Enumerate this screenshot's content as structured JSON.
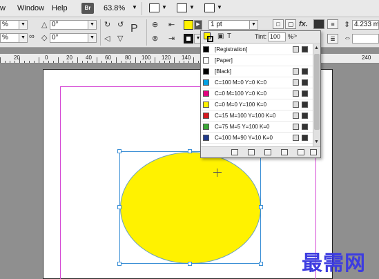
{
  "menubar": {
    "items": [
      "w",
      "Window",
      "Help"
    ],
    "bridge_label": "Br",
    "zoom": "63.8%"
  },
  "control": {
    "stroke_weight": "1 pt",
    "size_field": "4.233 m",
    "angle_1": "0°",
    "angle_2": "0°",
    "left_pct_1": "%",
    "left_pct_2": "%",
    "fx_label": "fx."
  },
  "ruler": {
    "labels": [
      "20",
      "0",
      "20",
      "40",
      "60",
      "80",
      "100",
      "120",
      "140"
    ],
    "right_labels": [
      "240"
    ]
  },
  "swatches_panel": {
    "tint_label": "Tint:",
    "tint_value": "100",
    "tint_unit": "%",
    "swatches": [
      {
        "name": "[Registration]",
        "color": "#000000"
      },
      {
        "name": "[Paper]",
        "color": "#ffffff"
      },
      {
        "name": "[Black]",
        "color": "#000000"
      },
      {
        "name": "C=100 M=0 Y=0 K=0",
        "color": "#00a0e3"
      },
      {
        "name": "C=0 M=100 Y=0 K=0",
        "color": "#e4007f"
      },
      {
        "name": "C=0 M=0 Y=100 K=0",
        "color": "#fff100"
      },
      {
        "name": "C=15 M=100 Y=100 K=0",
        "color": "#d7191f"
      },
      {
        "name": "C=75 M=5 Y=100 K=0",
        "color": "#3aa935"
      },
      {
        "name": "C=100 M=90 Y=10 K=0",
        "color": "#1f3a8c"
      }
    ]
  },
  "canvas": {
    "ellipse_fill": "#fff200"
  },
  "watermark": "最需网"
}
